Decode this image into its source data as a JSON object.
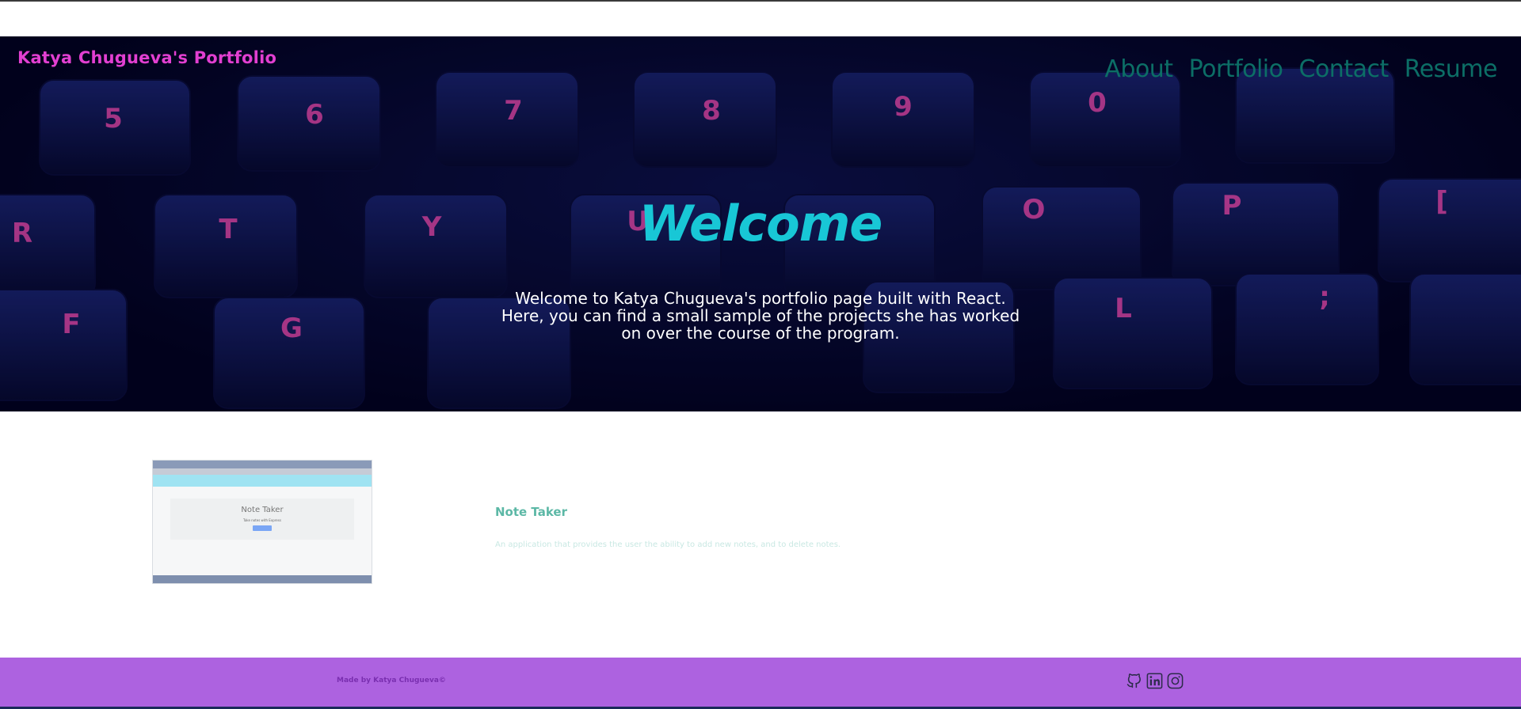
{
  "header": {
    "brand": "Katya Chugueva's Portfolio",
    "nav": [
      "About",
      "Portfolio",
      "Contact",
      "Resume"
    ]
  },
  "hero": {
    "title": "Welcome",
    "intro": "Welcome to Katya Chugueva's portfolio page built with React. Here, you can find a small sample of the projects she has worked on over the course of the program."
  },
  "project": {
    "title": "Note Taker",
    "description": "An application that provides the user the ability to add new notes, and to delete notes.",
    "thumbnail": {
      "title": "Note Taker",
      "subtitle": "Take notes with Express"
    }
  },
  "footer": {
    "text": "Made by Katya Chugueva©",
    "icons": [
      "github-icon",
      "linkedin-icon",
      "instagram-icon"
    ]
  },
  "colors": {
    "brand": "#e23fd1",
    "nav": "#0c6e66",
    "welcome": "#18c7d6",
    "footer_bg": "#ad62e0",
    "footer_text": "#7a2fb0",
    "project_title": "#5cb8a6"
  }
}
